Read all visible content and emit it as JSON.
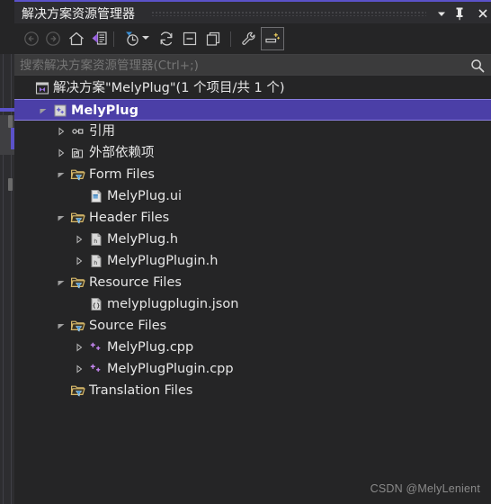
{
  "window": {
    "title": "解决方案资源管理器",
    "caption_buttons": [
      {
        "name": "dropdown",
        "label": "▼",
        "icon": "chevron-down-icon"
      },
      {
        "name": "pin",
        "label": "",
        "icon": "pin-icon"
      },
      {
        "name": "close",
        "label": "",
        "icon": "close-icon"
      }
    ]
  },
  "toolbar": {
    "items": [
      {
        "name": "back",
        "icon": "back-arrow-icon",
        "tooltip": "后退",
        "enabled": false
      },
      {
        "name": "forward",
        "icon": "forward-arrow-icon",
        "tooltip": "前进",
        "enabled": false
      },
      {
        "name": "home",
        "icon": "home-icon",
        "tooltip": "主页",
        "enabled": true
      },
      {
        "name": "sync-views",
        "icon": "sync-with-document-icon",
        "tooltip": "在解决方案资源管理器中同步",
        "enabled": true
      },
      {
        "name": "pending-changes",
        "icon": "filter-clock-icon",
        "tooltip": "挂起的更改筛选器",
        "enabled": true
      },
      {
        "name": "refresh",
        "icon": "refresh-icon",
        "tooltip": "刷新",
        "enabled": true
      },
      {
        "name": "collapse-all",
        "icon": "collapse-all-icon",
        "tooltip": "全部折叠",
        "enabled": true
      },
      {
        "name": "show-all-files",
        "icon": "show-all-files-icon",
        "tooltip": "显示所有文件",
        "enabled": true
      },
      {
        "name": "properties",
        "icon": "wrench-icon",
        "tooltip": "属性",
        "enabled": true
      },
      {
        "name": "preview-selected",
        "icon": "preview-pane-icon",
        "tooltip": "预览选定的项",
        "enabled": true,
        "active": true
      }
    ]
  },
  "search": {
    "placeholder": "搜索解决方案资源管理器(Ctrl+;)",
    "value": "",
    "icon": "search-icon"
  },
  "tree": {
    "nodes": [
      {
        "label": "解决方案\"MelyPlug\"(1 个项目/共 1 个)",
        "icon": "solution-icon",
        "indent": 0,
        "expander": "none",
        "selected": false
      },
      {
        "label": "MelyPlug",
        "icon": "cpp-project-icon",
        "indent": 1,
        "expander": "expanded",
        "selected": true
      },
      {
        "label": "引用",
        "icon": "references-icon",
        "indent": 2,
        "expander": "collapsed",
        "selected": false
      },
      {
        "label": "外部依赖项",
        "icon": "external-deps-icon",
        "indent": 2,
        "expander": "collapsed",
        "selected": false
      },
      {
        "label": "Form Files",
        "icon": "filter-folder-icon",
        "indent": 2,
        "expander": "expanded",
        "selected": false
      },
      {
        "label": "MelyPlug.ui",
        "icon": "ui-file-icon",
        "indent": 3,
        "expander": "none",
        "selected": false
      },
      {
        "label": "Header Files",
        "icon": "filter-folder-icon",
        "indent": 2,
        "expander": "expanded",
        "selected": false
      },
      {
        "label": "MelyPlug.h",
        "icon": "h-file-icon",
        "indent": 3,
        "expander": "collapsed",
        "selected": false
      },
      {
        "label": "MelyPlugPlugin.h",
        "icon": "h-file-icon",
        "indent": 3,
        "expander": "collapsed",
        "selected": false
      },
      {
        "label": "Resource Files",
        "icon": "filter-folder-icon",
        "indent": 2,
        "expander": "expanded",
        "selected": false
      },
      {
        "label": "melyplugplugin.json",
        "icon": "json-file-icon",
        "indent": 3,
        "expander": "none",
        "selected": false
      },
      {
        "label": "Source Files",
        "icon": "filter-folder-icon",
        "indent": 2,
        "expander": "expanded",
        "selected": false
      },
      {
        "label": "MelyPlug.cpp",
        "icon": "cpp-file-icon",
        "indent": 3,
        "expander": "collapsed",
        "selected": false
      },
      {
        "label": "MelyPlugPlugin.cpp",
        "icon": "cpp-file-icon",
        "indent": 3,
        "expander": "collapsed",
        "selected": false
      },
      {
        "label": "Translation Files",
        "icon": "filter-folder-icon",
        "indent": 2,
        "expander": "none",
        "selected": false
      }
    ]
  },
  "watermark": {
    "text": "CSDN @MelyLenient"
  },
  "colors": {
    "panel_bg": "#252526",
    "titlebar_bg": "#2d2d30",
    "accent_top": "#5b52c9",
    "selection_bg": "#4b3fa7",
    "selection_border": "#8a7fe0",
    "search_bg": "#3b3b3c",
    "text": "#e6e6e6",
    "folder": "#d8b96a",
    "cpp_purple": "#c586f0",
    "filter_blue": "#3b8fd4"
  }
}
